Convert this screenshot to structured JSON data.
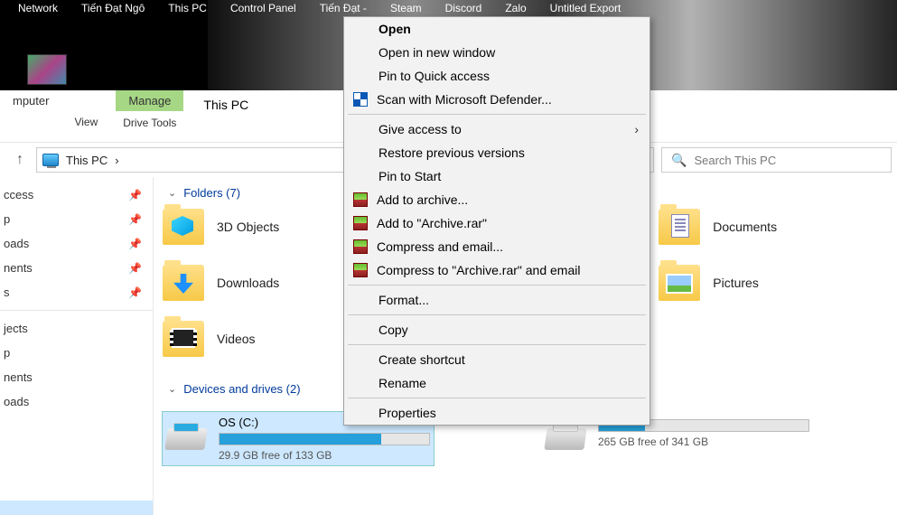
{
  "desktop": {
    "icons": [
      "Network",
      "Tiến Đạt Ngô",
      "This PC",
      "Control Panel",
      "Tiến Đạt -",
      "Steam",
      "Discord",
      "Zalo",
      "Untitled Export"
    ]
  },
  "ribbon": {
    "computer": "mputer",
    "view": "View",
    "manage": "Manage",
    "drivetools": "Drive Tools",
    "title": "This PC"
  },
  "addr": {
    "location": "This PC",
    "chev": "›",
    "refresh": "↻",
    "dropdown": "⌄",
    "search_placeholder": "Search This PC"
  },
  "side": {
    "items": [
      {
        "label": "ccess",
        "pin": true
      },
      {
        "label": "p",
        "pin": true
      },
      {
        "label": "oads",
        "pin": true
      },
      {
        "label": "nents",
        "pin": true
      },
      {
        "label": "s",
        "pin": true
      }
    ],
    "items2": [
      {
        "label": "jects"
      },
      {
        "label": "p"
      },
      {
        "label": "nents"
      },
      {
        "label": "oads"
      }
    ]
  },
  "groups": {
    "folders": "Folders (7)",
    "drives": "Devices and drives (2)"
  },
  "folders_left": [
    {
      "label": "3D Objects",
      "ov": "ov-cube"
    },
    {
      "label": "Downloads",
      "ov": "ov-down"
    },
    {
      "label": "Videos",
      "ov": "ov-vid"
    }
  ],
  "folders_right": [
    {
      "label": "Documents",
      "ov": "ov-doc"
    },
    {
      "label": "Pictures",
      "ov": "ov-pic"
    }
  ],
  "drives": [
    {
      "name": "OS (C:)",
      "free": "29.9 GB free of 133 GB",
      "fill": 77,
      "win": true,
      "sel": true
    },
    {
      "name": "",
      "free": "265 GB free of 341 GB",
      "fill": 22,
      "win": false,
      "sel": false
    }
  ],
  "ctx": [
    {
      "t": "Open",
      "bold": true
    },
    {
      "t": "Open in new window"
    },
    {
      "t": "Pin to Quick access"
    },
    {
      "t": "Scan with Microsoft Defender...",
      "ico": "defender"
    },
    {
      "sep": true
    },
    {
      "t": "Give access to",
      "sub": true
    },
    {
      "t": "Restore previous versions"
    },
    {
      "t": "Pin to Start"
    },
    {
      "t": "Add to archive...",
      "ico": "rar"
    },
    {
      "t": "Add to \"Archive.rar\"",
      "ico": "rar"
    },
    {
      "t": "Compress and email...",
      "ico": "rar"
    },
    {
      "t": "Compress to \"Archive.rar\" and email",
      "ico": "rar"
    },
    {
      "sep": true
    },
    {
      "t": "Format..."
    },
    {
      "sep": true
    },
    {
      "t": "Copy"
    },
    {
      "sep": true
    },
    {
      "t": "Create shortcut"
    },
    {
      "t": "Rename"
    },
    {
      "sep": true
    },
    {
      "t": "Properties"
    }
  ]
}
